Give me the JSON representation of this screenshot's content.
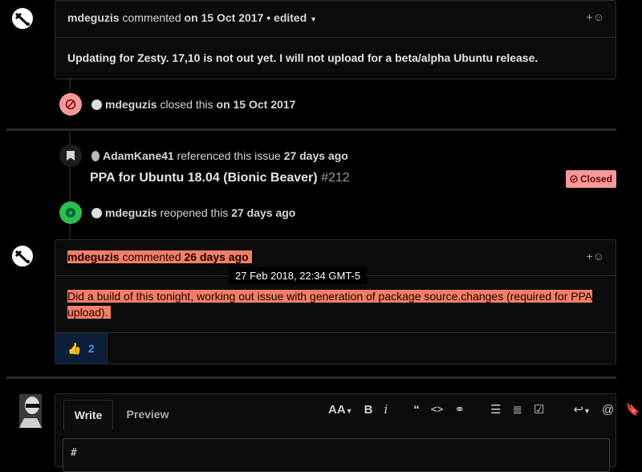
{
  "comment1": {
    "author": "mdeguzis",
    "action": "commented",
    "on_prefix": "on",
    "date": "15 Oct 2017",
    "separator": "•",
    "edited_label": "edited",
    "body": "Updating for Zesty. 17,10 is not out yet. I will not upload for a beta/alpha Ubuntu release."
  },
  "event_closed": {
    "author": "mdeguzis",
    "action": "closed this",
    "on_prefix": "on",
    "date": "15 Oct 2017"
  },
  "event_referenced": {
    "author": "AdamKane41",
    "action": "referenced this issue",
    "when": "27 days ago",
    "issue_title": "PPA for Ubuntu 18.04 (Bionic Beaver)",
    "issue_number": "#212",
    "status_label": "Closed"
  },
  "event_reopened": {
    "author": "mdeguzis",
    "action": "reopened this",
    "when": "27 days ago"
  },
  "comment2": {
    "author": "mdeguzis",
    "action": "commented",
    "when": "26 days ago",
    "tooltip": "27 Feb 2018, 22:34 GMT-5",
    "body": "Did a build of this tonight, working out issue with generation of package source.changes (required for PPA upload).",
    "reaction_count": "2"
  },
  "composer": {
    "tab_write": "Write",
    "tab_preview": "Preview",
    "input_value": "#"
  },
  "colors": {
    "closed_red": "#f49a9a",
    "open_green": "#2cbe4e",
    "highlight": "#f08065",
    "link_blue": "#4b91e8"
  }
}
